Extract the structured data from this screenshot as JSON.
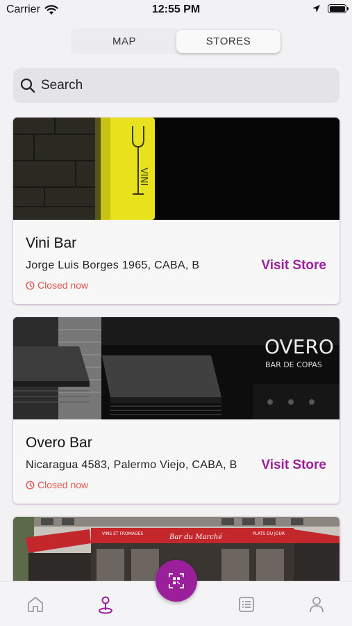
{
  "status_bar": {
    "carrier": "Carrier",
    "time": "12:55 PM"
  },
  "segment": {
    "tabs": [
      {
        "label": "MAP",
        "active": false
      },
      {
        "label": "STORES",
        "active": true
      }
    ]
  },
  "search": {
    "placeholder": "Search",
    "value": ""
  },
  "stores": [
    {
      "name": "Vini Bar",
      "address": "Jorge Luis Borges 1965, CABA, B",
      "status": "Closed now",
      "action": "Visit Store",
      "image_icon": "vini-bar-storefront"
    },
    {
      "name": "Overo Bar",
      "address": "Nicaragua 4583, Palermo Viejo, CABA, B",
      "status": "Closed now",
      "action": "Visit Store",
      "image_icon": "overo-bar-storefront",
      "sign_text": [
        "OVERO",
        "BAR DE COPAS"
      ]
    },
    {
      "image_icon": "bar-du-marche-storefront",
      "sign_text": [
        "Bar du Marché",
        "VINS ET FROMAGES",
        "PLATS DU JOUR"
      ]
    }
  ],
  "tab_bar": {
    "items": [
      {
        "icon": "home-icon",
        "active": false
      },
      {
        "icon": "map-pin-icon",
        "active": true
      },
      {
        "icon": "qr-scan-icon",
        "active": false
      },
      {
        "icon": "list-icon",
        "active": false
      },
      {
        "icon": "profile-icon",
        "active": false
      }
    ]
  },
  "colors": {
    "accent": "#9b1f9a",
    "closed": "#e2574c",
    "background": "#f2f2f4"
  }
}
